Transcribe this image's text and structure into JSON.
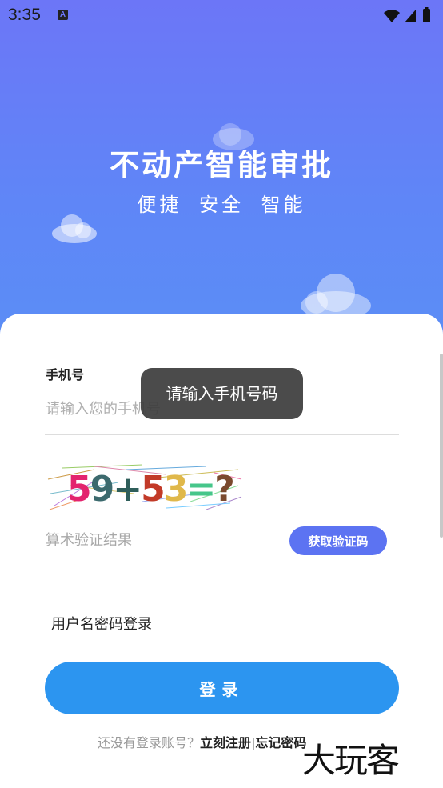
{
  "status_bar": {
    "time": "3:35",
    "notification_icon": "a-letter-icon",
    "icons": [
      "wifi-icon",
      "signal-icon",
      "battery-icon"
    ]
  },
  "hero": {
    "title": "不动产智能审批",
    "subtitle": "便捷 安全 智能",
    "background_colors": [
      "#6c76f7",
      "#5a8ff6"
    ]
  },
  "form": {
    "phone_label": "手机号",
    "phone_placeholder": "请输入您的手机号",
    "phone_value": "",
    "captcha": {
      "parts": [
        {
          "text": "5",
          "color": "#e3246e"
        },
        {
          "text": "9",
          "color": "#3c6a6e"
        },
        {
          "text": "+",
          "color": "#2f5e5a"
        },
        {
          "text": "5",
          "color": "#c23a28"
        },
        {
          "text": "3",
          "color": "#e0b84a"
        },
        {
          "text": "=",
          "color": "#46c68a"
        },
        {
          "text": "?",
          "color": "#7a4a2e"
        }
      ]
    },
    "calc_placeholder": "算术验证结果",
    "get_code_label": "获取验证码",
    "password_login_label": "用户名密码登录",
    "login_label": "登录"
  },
  "footer": {
    "prompt": "还没有登录账号？",
    "register_label": "立刻注册",
    "separator": "|",
    "forgot_label": "忘记密码"
  },
  "toast": {
    "message": "请输入手机号码"
  },
  "watermark": {
    "text": "大玩客"
  },
  "colors": {
    "accent": "#2c95f0",
    "code_button": "#5c73f2"
  }
}
